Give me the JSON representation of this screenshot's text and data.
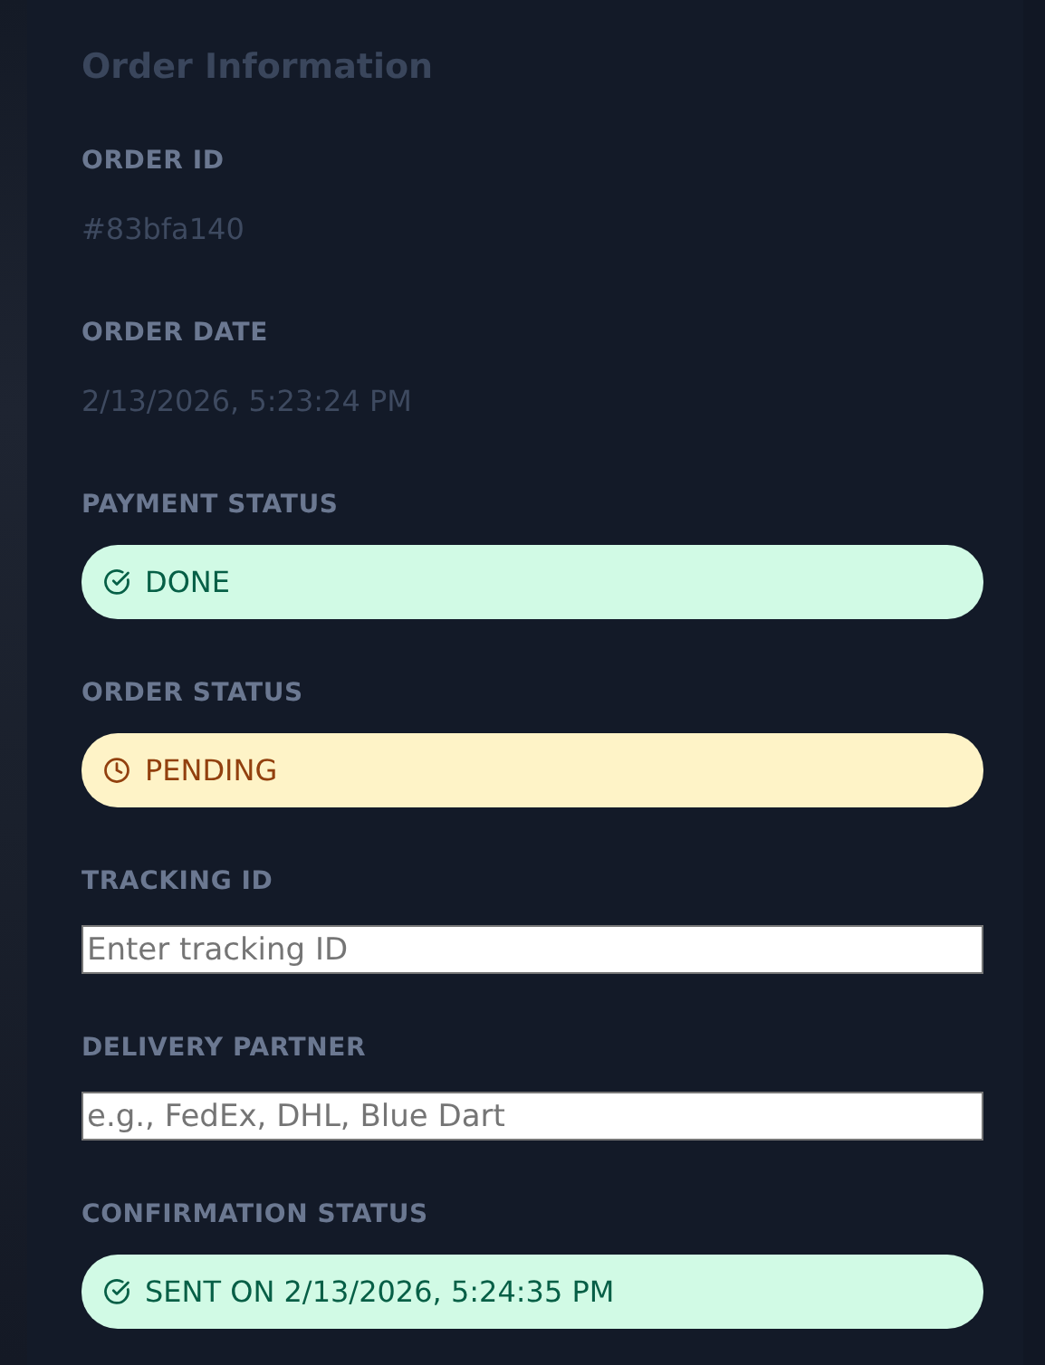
{
  "title": "Order Information",
  "fields": [
    {
      "kind": "text",
      "label": "ORDER ID",
      "value": "#83bfa140"
    },
    {
      "kind": "text",
      "label": "ORDER DATE",
      "value": "2/13/2026, 5:23:24 PM"
    },
    {
      "kind": "badge",
      "label": "PAYMENT STATUS",
      "value": "DONE",
      "color": "#d1fae5"
    },
    {
      "kind": "badge",
      "label": "ORDER STATUS",
      "value": "PENDING",
      "color": "#fef3c7"
    },
    {
      "kind": "input",
      "label": "TRACKING ID",
      "placeholder": "Enter tracking ID"
    },
    {
      "kind": "input",
      "label": "DELIVERY PARTNER",
      "placeholder": "e.g., FedEx, DHL, Blue Dart"
    },
    {
      "kind": "badge",
      "label": "CONFIRMATION STATUS",
      "value": "SENT ON 2/13/2026, 5:24:35 PM",
      "color": "#d1fae5"
    }
  ]
}
